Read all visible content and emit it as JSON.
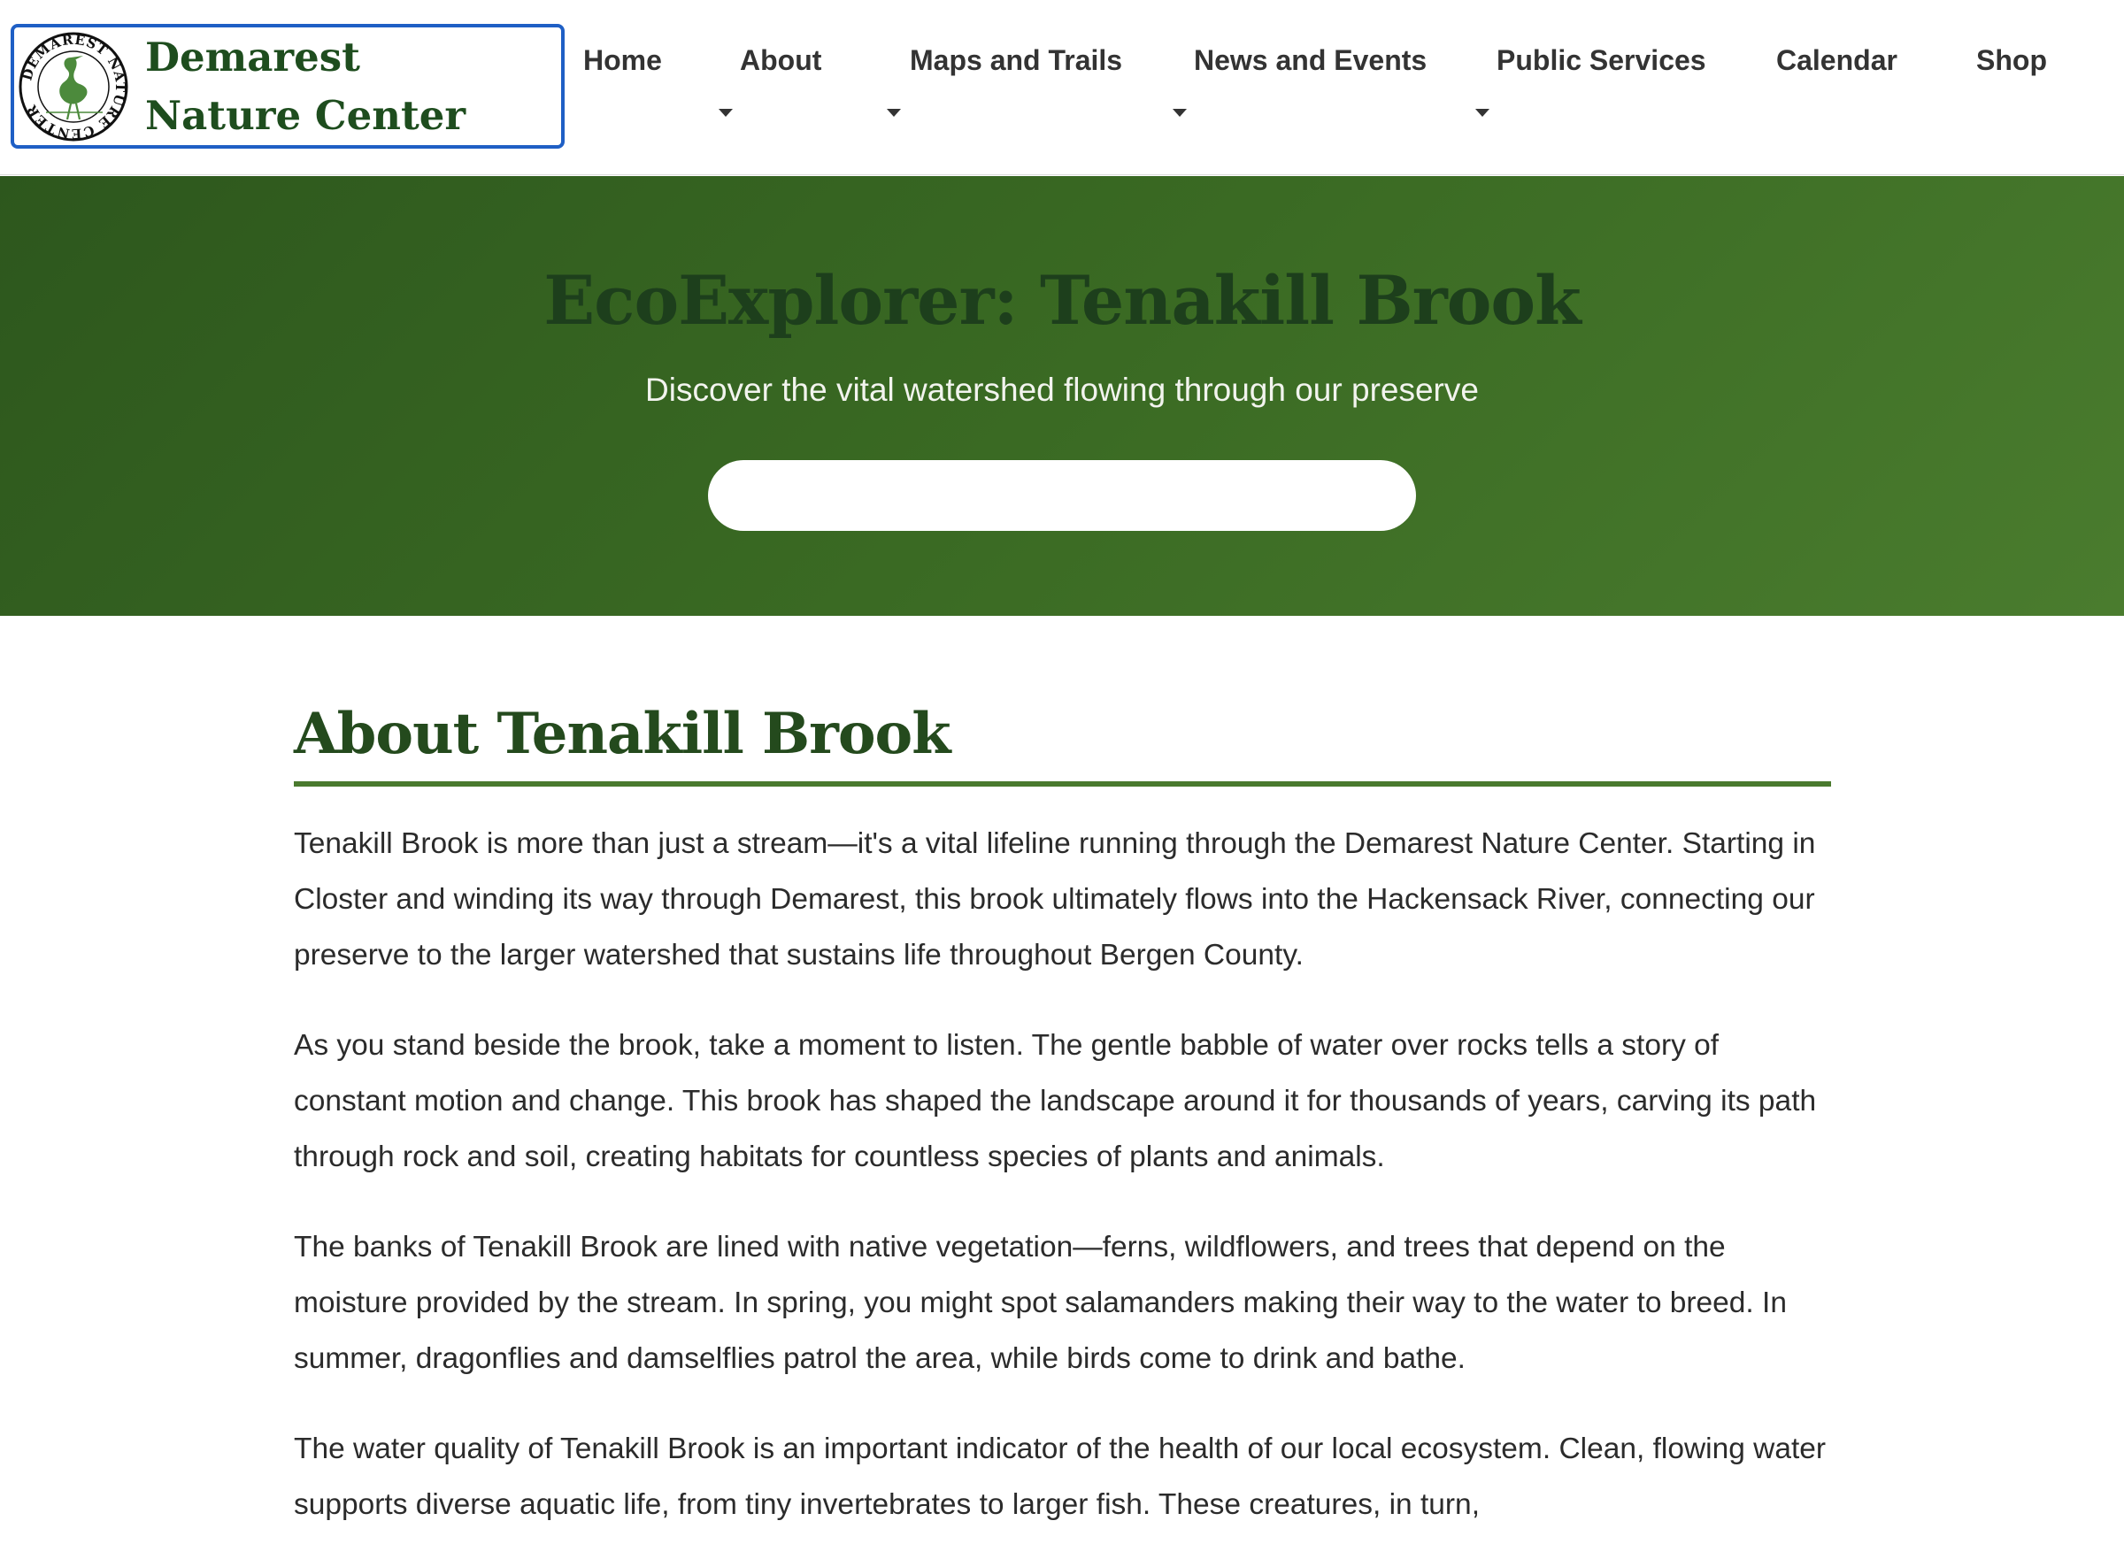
{
  "brand": {
    "name": "Demarest Nature Center",
    "logo_icon": "heron-seal-icon",
    "seal_text": "DEMAREST NATURE CENTER",
    "color": "#1e4d1e"
  },
  "nav": {
    "items": [
      {
        "label": "Home",
        "has_dropdown": false
      },
      {
        "label": "About",
        "has_dropdown": true
      },
      {
        "label": "Maps and Trails",
        "has_dropdown": true
      },
      {
        "label": "News and Events",
        "has_dropdown": true
      },
      {
        "label": "Public Services",
        "has_dropdown": true
      },
      {
        "label": "Calendar",
        "has_dropdown": false
      },
      {
        "label": "Shop",
        "has_dropdown": false
      }
    ]
  },
  "hero": {
    "title": "EcoExplorer: Tenakill Brook",
    "subtitle": "Discover the vital watershed flowing through our preserve",
    "search_value": "",
    "background_color": "#3a6a23"
  },
  "main": {
    "title": "About Tenakill Brook",
    "accent_color": "#4a7a2e",
    "paragraphs": [
      "Tenakill Brook is more than just a stream—it's a vital lifeline running through the Demarest Nature Center. Starting in Closter and winding its way through Demarest, this brook ultimately flows into the Hackensack River, connecting our preserve to the larger watershed that sustains life throughout Bergen County.",
      "As you stand beside the brook, take a moment to listen. The gentle babble of water over rocks tells a story of constant motion and change. This brook has shaped the landscape around it for thousands of years, carving its path through rock and soil, creating habitats for countless species of plants and animals.",
      "The banks of Tenakill Brook are lined with native vegetation—ferns, wildflowers, and trees that depend on the moisture provided by the stream. In spring, you might spot salamanders making their way to the water to breed. In summer, dragonflies and damselflies patrol the area, while birds come to drink and bathe.",
      "The water quality of Tenakill Brook is an important indicator of the health of our local ecosystem. Clean, flowing water supports diverse aquatic life, from tiny invertebrates to larger fish. These creatures, in turn,"
    ]
  }
}
